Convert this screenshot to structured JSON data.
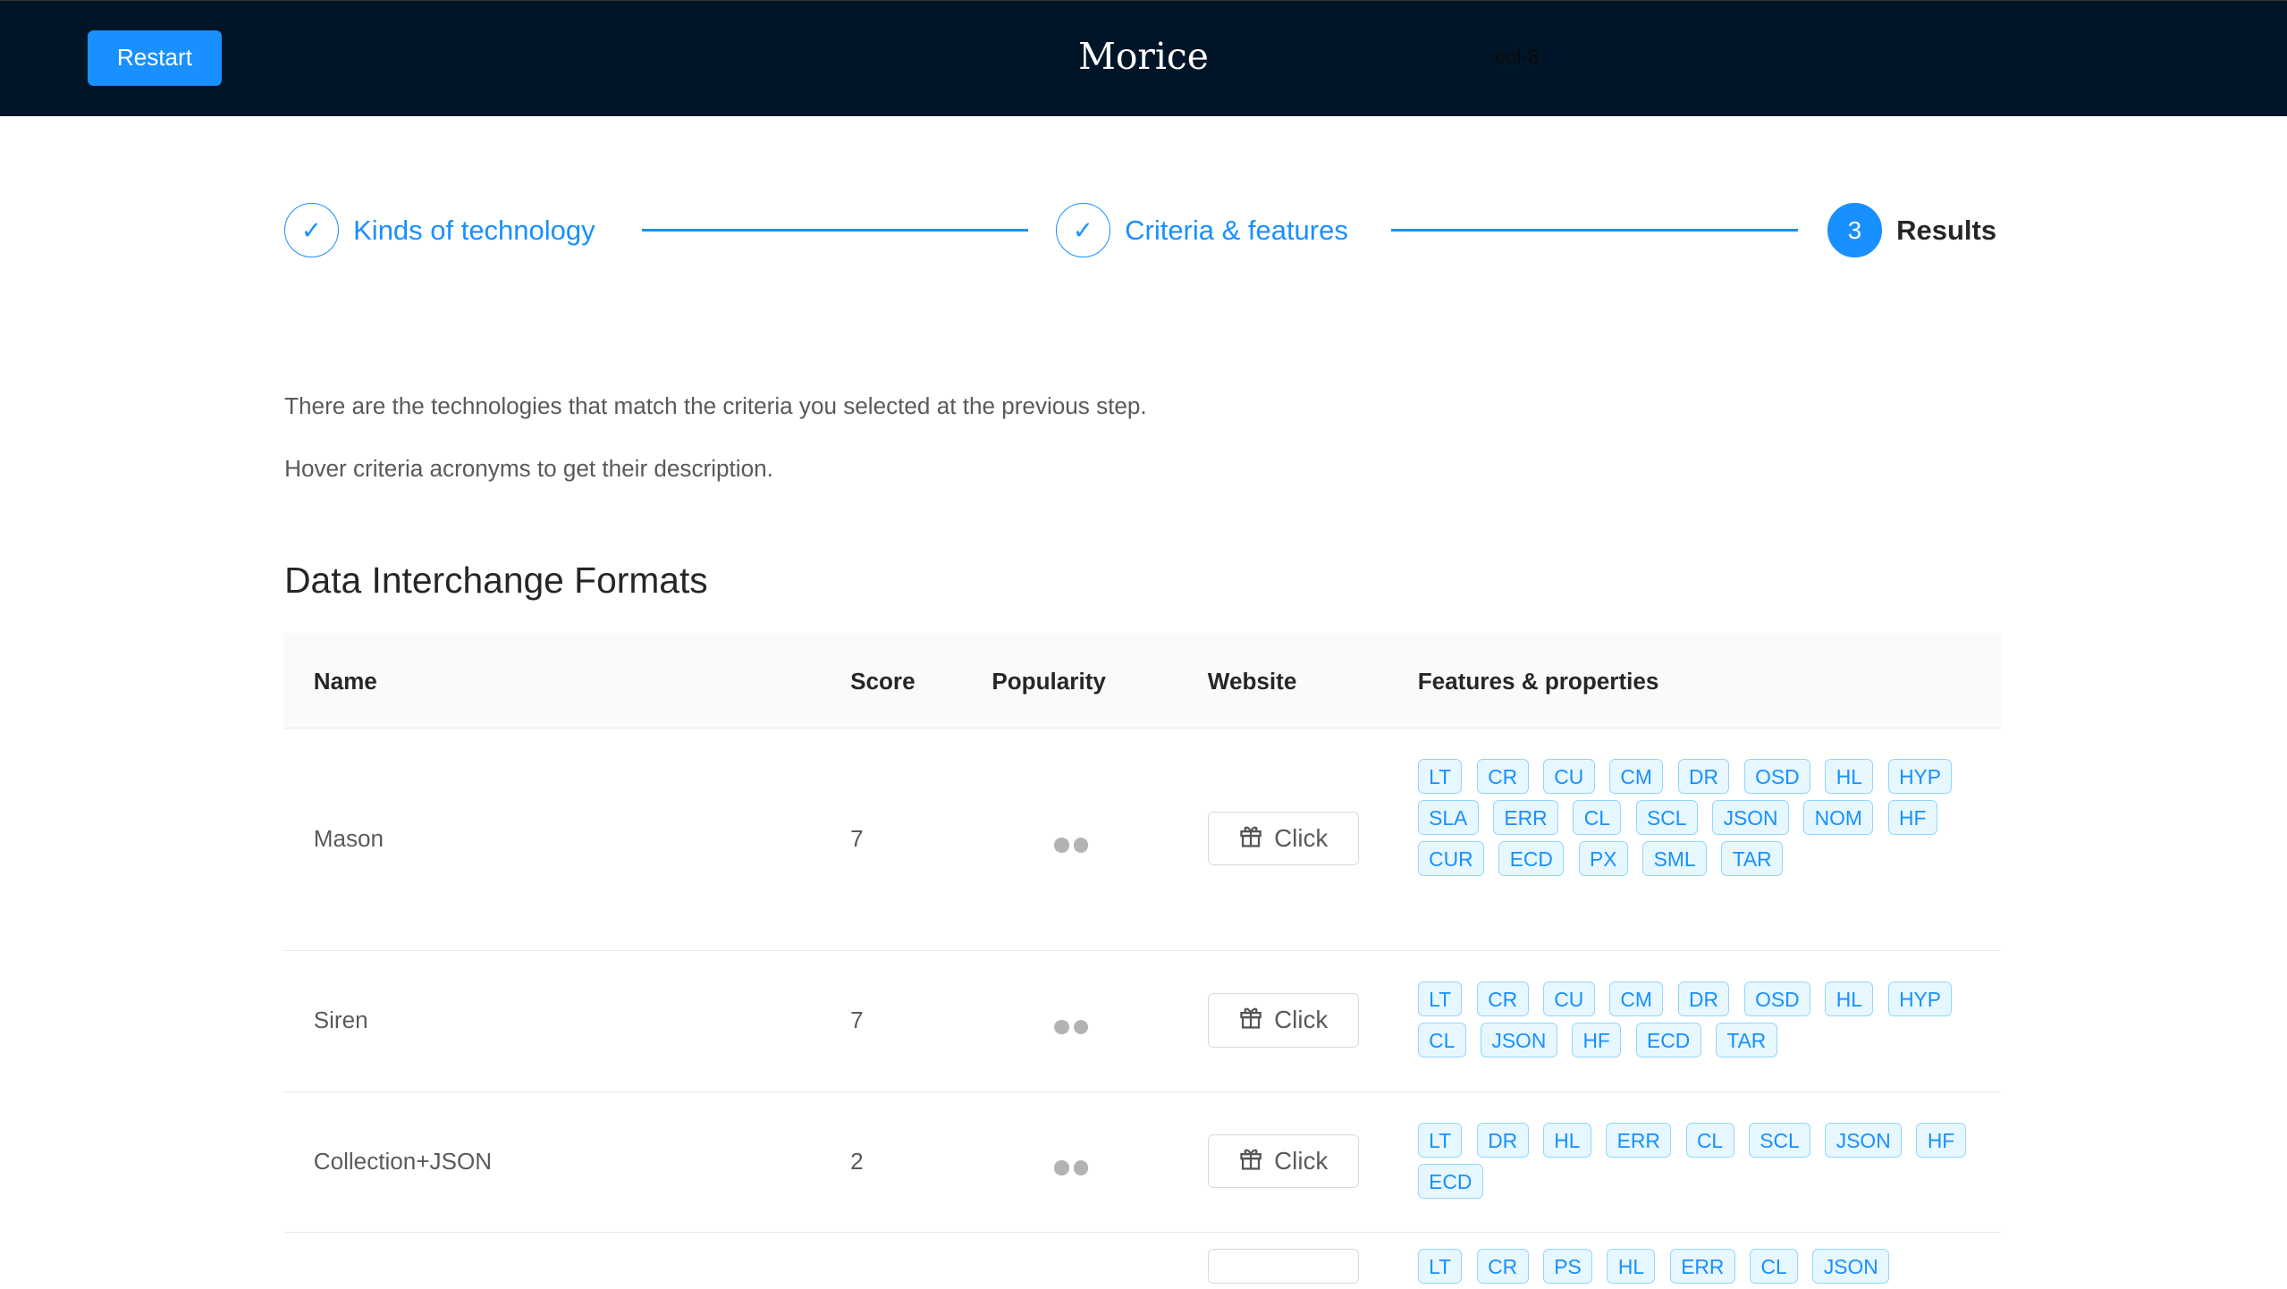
{
  "header": {
    "restart_label": "Restart",
    "brand": "Morice",
    "col_label": "col-8"
  },
  "steps": [
    {
      "label": "Kinds of technology",
      "icon": "check-icon"
    },
    {
      "label": "Criteria & features",
      "icon": "check-icon"
    },
    {
      "label": "Results",
      "number": "3"
    }
  ],
  "intro": [
    "There are the technologies that match the criteria you selected at the previous step.",
    "Hover criteria acronyms to get their description."
  ],
  "section_title": "Data Interchange Formats",
  "table": {
    "headers": {
      "name": "Name",
      "score": "Score",
      "popularity": "Popularity",
      "website": "Website",
      "features": "Features & properties"
    },
    "rows": [
      {
        "name": "Mason",
        "score": "7",
        "popularity": 2,
        "website": "Click",
        "tags": [
          "LT",
          "CR",
          "CU",
          "CM",
          "DR",
          "OSD",
          "HL",
          "HYP",
          "SLA",
          "ERR",
          "CL",
          "SCL",
          "JSON",
          "NOM",
          "HF",
          "CUR",
          "ECD",
          "PX",
          "SML",
          "TAR"
        ]
      },
      {
        "name": "Siren",
        "score": "7",
        "popularity": 2,
        "website": "Click",
        "tags": [
          "LT",
          "CR",
          "CU",
          "CM",
          "DR",
          "OSD",
          "HL",
          "HYP",
          "CL",
          "JSON",
          "HF",
          "ECD",
          "TAR"
        ]
      },
      {
        "name": "Collection+JSON",
        "score": "2",
        "popularity": 2,
        "website": "Click",
        "tags": [
          "LT",
          "DR",
          "HL",
          "ERR",
          "CL",
          "SCL",
          "JSON",
          "HF",
          "ECD"
        ]
      },
      {
        "name": "",
        "score": "",
        "popularity": 0,
        "website": "",
        "tags": [
          "LT",
          "CR",
          "PS",
          "HL",
          "ERR",
          "CL",
          "JSON"
        ]
      }
    ]
  },
  "colors": {
    "accent": "#1890ff",
    "topbar": "#001628"
  }
}
